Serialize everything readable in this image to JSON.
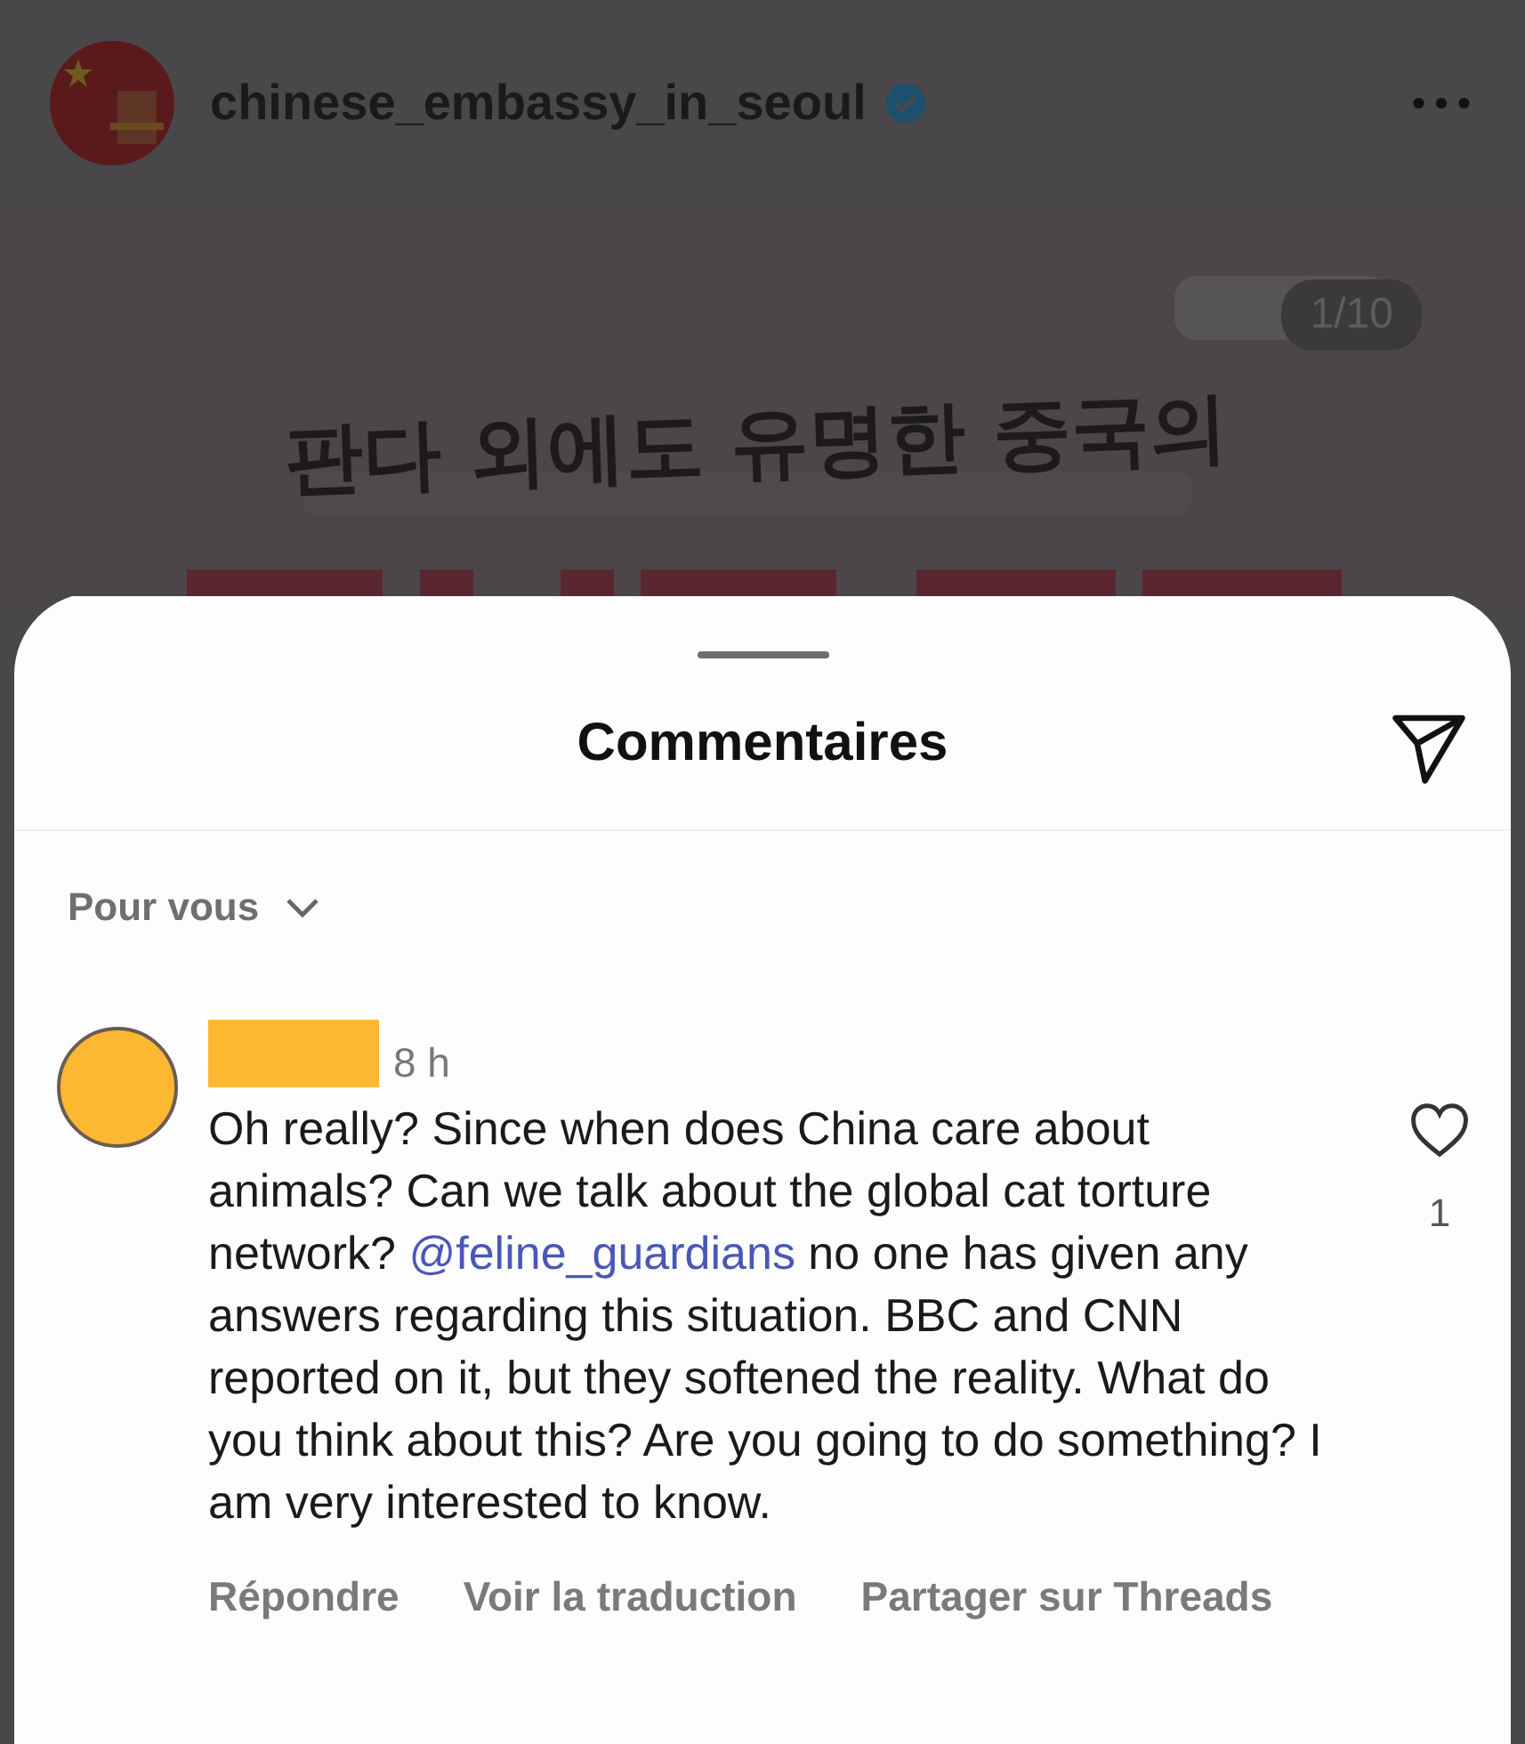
{
  "post_header": {
    "username": "chinese_embassy_in_seoul",
    "verified": true
  },
  "post": {
    "kind": "picture",
    "counter": "1/10",
    "headline": "판다 외에도 유명한 중국의"
  },
  "comments_sheet": {
    "title": "Commentaires",
    "sort": "Pour vous",
    "comments": [
      {
        "username_redacted": true,
        "time": "8 h",
        "likes": "1",
        "liked": false,
        "body": [
          {
            "kind": "text",
            "text": "Oh really? Since when does China care about animals? Can we talk about the global cat torture network? "
          },
          {
            "kind": "mention",
            "text": "@feline_guardians"
          },
          {
            "kind": "text",
            "text": " no one has given any answers regarding this situation. BBC and CNN reported on it, but they softened the reality. What do you think about this? Are you going to do something? I am very interested to know."
          }
        ],
        "actions": [
          "Répondre",
          "Voir la traduction",
          "Partager sur Threads"
        ]
      }
    ]
  }
}
